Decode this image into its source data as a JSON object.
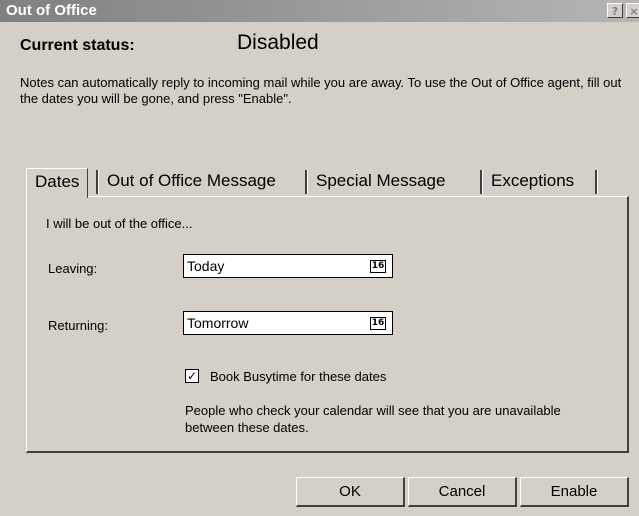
{
  "window": {
    "title": "Out of Office",
    "help_glyph": "?",
    "close_glyph": "×"
  },
  "status": {
    "label": "Current status:",
    "value": "Disabled"
  },
  "description": "Notes can automatically reply to incoming mail while you are away. To use the Out of Office agent, fill out the dates you will be gone, and press \"Enable\".",
  "tabs": [
    {
      "label": "Dates",
      "active": true
    },
    {
      "label": "Out of Office Message",
      "active": false
    },
    {
      "label": "Special Message",
      "active": false
    },
    {
      "label": "Exceptions",
      "active": false
    }
  ],
  "dates_tab": {
    "intro": "I will be out of the office...",
    "leaving_label": "Leaving:",
    "leaving_value": "Today",
    "returning_label": "Returning:",
    "returning_value": "Tomorrow",
    "calendar_icon_text": "16",
    "busytime_checked": true,
    "busytime_label": "Book Busytime for these dates",
    "busytime_note": "People who check your calendar will see that you are unavailable between these dates."
  },
  "buttons": {
    "ok": "OK",
    "cancel": "Cancel",
    "enable": "Enable"
  }
}
